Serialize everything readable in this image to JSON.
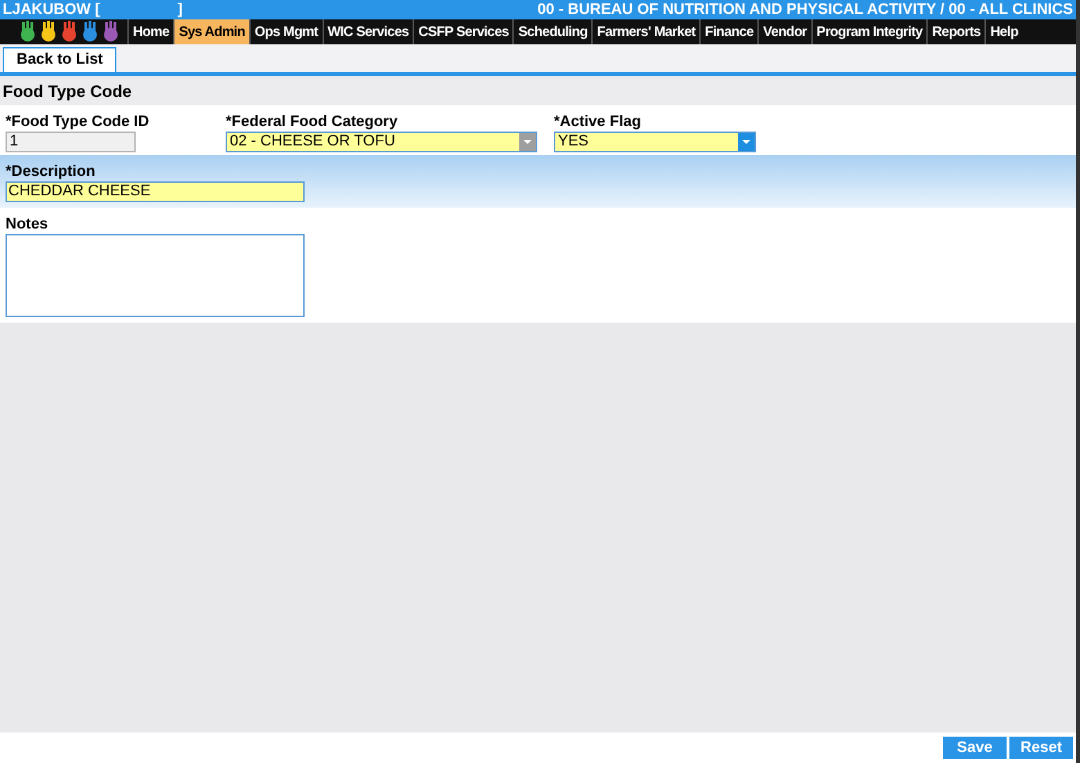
{
  "header": {
    "user": "LJAKUBOW [",
    "user_close": "]",
    "agency": "00 - BUREAU OF NUTRITION AND PHYSICAL ACTIVITY / 00 - ALL CLINICS"
  },
  "nav": [
    {
      "label": "Home",
      "selected": false
    },
    {
      "label": "Sys Admin",
      "selected": true
    },
    {
      "label": "Ops Mgmt",
      "selected": false
    },
    {
      "label": "WIC Services",
      "selected": false
    },
    {
      "label": "CSFP Services",
      "selected": false
    },
    {
      "label": "Scheduling",
      "selected": false
    },
    {
      "label": "Farmers' Market",
      "selected": false
    },
    {
      "label": "Finance",
      "selected": false
    },
    {
      "label": "Vendor",
      "selected": false
    },
    {
      "label": "Program Integrity",
      "selected": false
    },
    {
      "label": "Reports",
      "selected": false
    },
    {
      "label": "Help",
      "selected": false
    }
  ],
  "back_tab": "Back to List",
  "section_title": "Food Type Code",
  "fields": [
    {
      "kind": "text",
      "label": "*Food Type Code ID",
      "value": "1",
      "disabled": true
    },
    {
      "kind": "select",
      "label": "*Federal Food Category",
      "value": "02 - CHEESE OR TOFU",
      "disabled": true
    },
    {
      "kind": "select",
      "label": "*Active Flag",
      "value": "YES",
      "disabled": false
    }
  ],
  "description": {
    "label": "*Description",
    "value": "CHEDDAR CHEESE"
  },
  "notes": {
    "label": "Notes"
  },
  "buttons": [
    "Save",
    "Reset"
  ]
}
